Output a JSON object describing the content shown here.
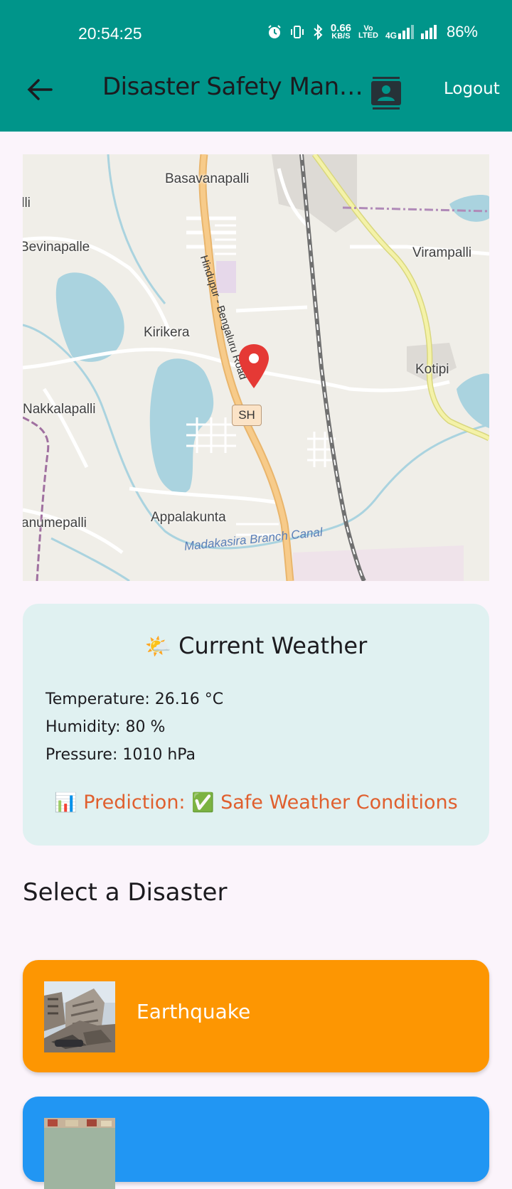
{
  "status_bar": {
    "time": "20:54:25",
    "net_speed_top": "0.66",
    "net_speed_bottom": "KB/S",
    "volte_top": "Vo",
    "volte_bottom": "LTED",
    "network_type": "4G",
    "battery": "86%"
  },
  "app_bar": {
    "title": "Disaster Safety Man…",
    "logout_label": "Logout",
    "color": "#00958A"
  },
  "map": {
    "labels": {
      "basavanapalli": "Basavanapalli",
      "lli": "illi",
      "bevinapalle": "Bevinapalle",
      "virampalli": "Virampalli",
      "kirikera": "Kirikera",
      "kotipi": "Kotipi",
      "nakkalapalli": "Nakkalapalli",
      "anumepalli": "anumepalli",
      "appalakunta": "Appalakunta"
    },
    "road_label": "Hindupur - Bengaluru Road",
    "canal_label": "Madakasira Branch Canal",
    "highway_badge": "SH",
    "marker_color": "#E53935"
  },
  "weather": {
    "title": "Current Weather",
    "temperature": "Temperature: 26.16 °C",
    "humidity": "Humidity: 80 %",
    "pressure": "Pressure: 1010 hPa",
    "prediction_label": "Prediction:",
    "prediction_value": "Safe Weather Conditions",
    "title_icon": "sun-behind-cloud-icon",
    "prediction_icon": "bar-chart-icon",
    "status_icon": "check-mark-icon"
  },
  "section_title": "Select a Disaster",
  "disasters": [
    {
      "label": "Earthquake",
      "color": "#FD9602"
    },
    {
      "label": "",
      "color": "#2196F3"
    }
  ]
}
